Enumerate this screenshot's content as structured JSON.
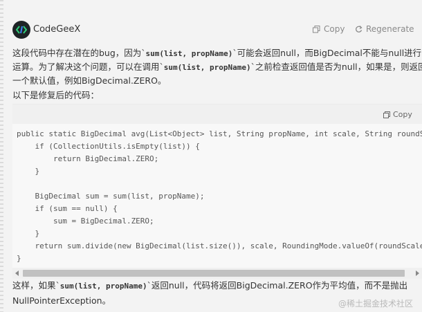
{
  "header": {
    "app_name": "CodeGeeX",
    "copy_label": "Copy",
    "regenerate_label": "Regenerate"
  },
  "response": {
    "p1_a": "这段代码中存在潜在的bug，因为`",
    "p1_code": "sum(list, propName)",
    "p1_b": "`可能会返回null，而BigDecimal不能与null进行除法",
    "p2_a": "运算。为了解决这个问题，可以在调用`",
    "p2_code": "sum(list, propName)",
    "p2_b": "`之前检查返回值是否为null，如果是，则返回",
    "p3": "一个默认值，例如BigDecimal.ZERO。",
    "p4": "以下是修复后的代码：",
    "p5_a": "这样，如果`",
    "p5_code": "sum(list, propName)",
    "p5_b": "`返回null，代码将返回BigDecimal.ZERO作为平均值，而不是抛出",
    "p6": "NullPointerException。"
  },
  "code": {
    "copy_label": "Copy",
    "lines": [
      "public static BigDecimal avg(List<Object> list, String propName, int scale, String roundScale",
      "    if (CollectionUtils.isEmpty(list)) {",
      "        return BigDecimal.ZERO;",
      "    }",
      "",
      "    BigDecimal sum = sum(list, propName);",
      "    if (sum == null) {",
      "        sum = BigDecimal.ZERO;",
      "    }",
      "    return sum.divide(new BigDecimal(list.size()), scale, RoundingMode.valueOf(roundScale));",
      "}"
    ]
  },
  "watermark": "@稀土掘金技术社区"
}
